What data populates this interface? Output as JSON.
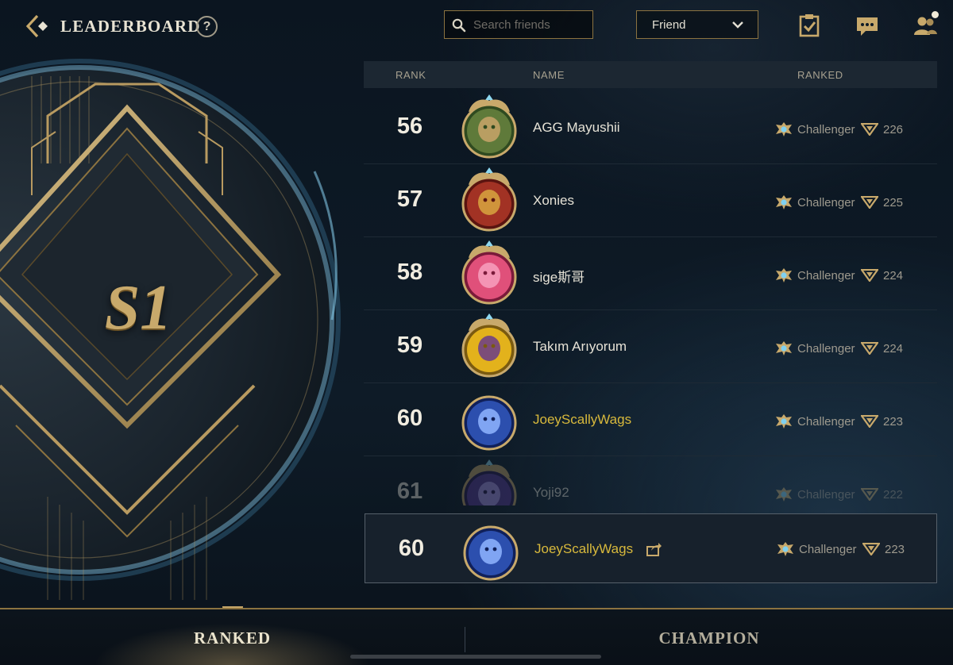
{
  "header": {
    "title": "LEADERBOARD",
    "help_label": "?",
    "search_placeholder": "Search friends",
    "filter_value": "Friend"
  },
  "season": {
    "label": "S1"
  },
  "table": {
    "columns": {
      "rank": "RANK",
      "name": "NAME",
      "ranked": "RANKED"
    }
  },
  "rows": [
    {
      "rank": "56",
      "name": "AGG Mayushii",
      "tier": "Challenger",
      "points": "226",
      "avatar": "green-hooded-champion",
      "is_self": false
    },
    {
      "rank": "57",
      "name": "Xonies",
      "tier": "Challenger",
      "points": "225",
      "avatar": "golden-bull-champion",
      "is_self": false
    },
    {
      "rank": "58",
      "name": "sige斯哥",
      "tier": "Challenger",
      "points": "224",
      "avatar": "pink-heart-icon",
      "is_self": false
    },
    {
      "rank": "59",
      "name": "Takım Arıyorum",
      "tier": "Challenger",
      "points": "224",
      "avatar": "yellow-champion",
      "is_self": false
    },
    {
      "rank": "60",
      "name": "JoeyScallyWags",
      "tier": "Challenger",
      "points": "223",
      "avatar": "blue-cosmic-champion",
      "is_self": true
    },
    {
      "rank": "61",
      "name": "Yoji92",
      "tier": "Challenger",
      "points": "222",
      "avatar": "purple-champion",
      "is_self": false
    }
  ],
  "my_rank": {
    "rank": "60",
    "name": "JoeyScallyWags",
    "tier": "Challenger",
    "points": "223"
  },
  "tabs": {
    "ranked": "RANKED",
    "champion": "CHAMPION",
    "active": "ranked"
  },
  "colors": {
    "gold": "#c8a96b",
    "self_name": "#d8b93c",
    "border": "#8c7340"
  }
}
